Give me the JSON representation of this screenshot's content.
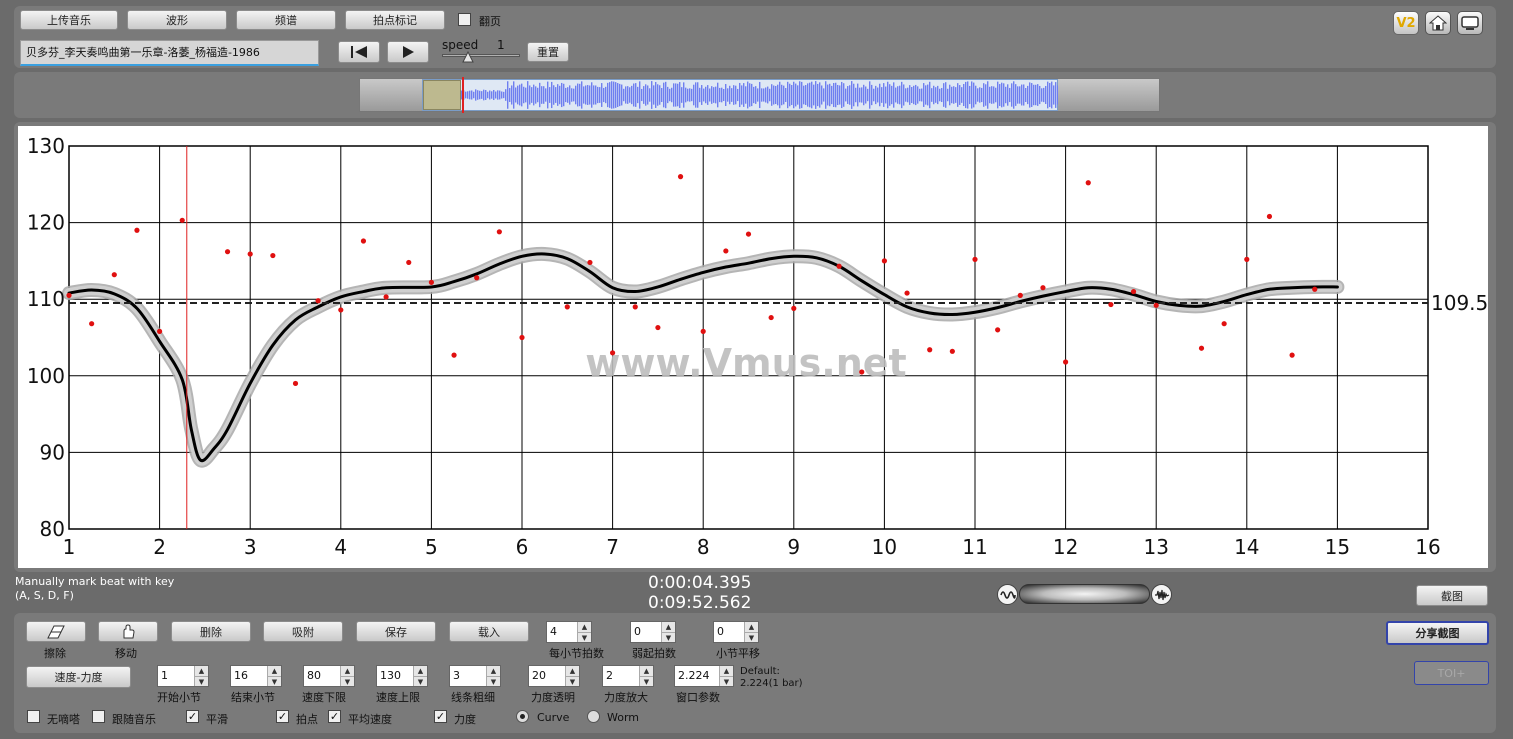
{
  "toolbar": {
    "upload": "上传音乐",
    "waveform": "波形",
    "spectrum": "频谱",
    "beat_mark": "拍点标记",
    "page_turn": "翻页",
    "title_value": "贝多芬_李天奏鸣曲第一乐章-洛萎_杨福造-1986",
    "speed_label": "speed",
    "speed_value": "1",
    "reset": "重置",
    "version_badge": "V2"
  },
  "overview": {
    "start_fraction": 0.058,
    "window_start": 0.078,
    "window_end": 0.873
  },
  "marker_note": "Manually mark beat with key",
  "marker_keys": "(A, S, D, F)",
  "time_current": "0:00:04.395",
  "time_total": "0:09:52.562",
  "screenshot_btn": "截图",
  "share_btn": "分享截图",
  "toi_btn": "TOI+",
  "watermark": "www.Vmus.net",
  "controls": {
    "erase": "擦除",
    "move": "移动",
    "delete": "删除",
    "snap": "吸附",
    "save": "保存",
    "load": "载入",
    "beats_per_bar_label": "每小节拍数",
    "beats_per_bar": "4",
    "pickup_label": "弱起拍数",
    "pickup": "0",
    "bar_shift_label": "小节平移",
    "bar_shift": "0",
    "tempo_dynamics": "速度-力度",
    "start_bar_label": "开始小节",
    "start_bar": "1",
    "end_bar_label": "结束小节",
    "end_bar": "16",
    "tempo_min_label": "速度下限",
    "tempo_min": "80",
    "tempo_max_label": "速度上限",
    "tempo_max": "130",
    "line_width_label": "线条粗细",
    "line_width": "3",
    "dyn_opacity_label": "力度透明",
    "dyn_opacity": "20",
    "dyn_scale_label": "力度放大",
    "dyn_scale": "2",
    "window_label": "窗口参数",
    "window": "2.224",
    "default_line1": "Default:",
    "default_line2": "2.224(1 bar)",
    "no_metronome": "无嘀嗒",
    "follow_music": "跟随音乐",
    "smooth": "平滑",
    "beats": "拍点",
    "avg_tempo": "平均速度",
    "dynamics": "力度",
    "curve": "Curve",
    "worm": "Worm"
  },
  "chart_data": {
    "type": "scatter",
    "xlim": [
      1,
      16
    ],
    "ylim": [
      80,
      130
    ],
    "x_ticks": [
      "1",
      "2",
      "3",
      "4",
      "5",
      "6",
      "7",
      "8",
      "9",
      "10",
      "11",
      "12",
      "13",
      "14",
      "15",
      "16"
    ],
    "y_ticks": [
      "130",
      "120",
      "110",
      "100",
      "90",
      "80"
    ],
    "average": 109.5,
    "average_label": "109.5",
    "cursor_x": 2.3,
    "points": [
      [
        1.0,
        110.5
      ],
      [
        1.25,
        106.8
      ],
      [
        1.5,
        113.2
      ],
      [
        1.75,
        119.0
      ],
      [
        2.0,
        105.8
      ],
      [
        2.25,
        120.3
      ],
      [
        2.75,
        116.2
      ],
      [
        3.0,
        115.9
      ],
      [
        3.25,
        115.7
      ],
      [
        3.5,
        99.0
      ],
      [
        3.75,
        109.8
      ],
      [
        4.0,
        108.6
      ],
      [
        4.25,
        117.6
      ],
      [
        4.5,
        110.3
      ],
      [
        4.75,
        114.8
      ],
      [
        5.0,
        112.2
      ],
      [
        5.25,
        102.7
      ],
      [
        5.5,
        112.8
      ],
      [
        5.75,
        118.8
      ],
      [
        6.0,
        105.0
      ],
      [
        6.5,
        109.0
      ],
      [
        6.75,
        114.8
      ],
      [
        7.0,
        103.0
      ],
      [
        7.25,
        109.0
      ],
      [
        7.5,
        106.3
      ],
      [
        7.75,
        126.0
      ],
      [
        8.0,
        105.8
      ],
      [
        8.25,
        116.3
      ],
      [
        8.5,
        118.5
      ],
      [
        8.75,
        107.6
      ],
      [
        9.0,
        108.8
      ],
      [
        9.5,
        114.3
      ],
      [
        9.75,
        100.5
      ],
      [
        10.0,
        115.0
      ],
      [
        10.25,
        110.8
      ],
      [
        10.5,
        103.4
      ],
      [
        10.75,
        103.2
      ],
      [
        11.0,
        115.2
      ],
      [
        11.25,
        106.0
      ],
      [
        11.5,
        110.5
      ],
      [
        11.75,
        111.5
      ],
      [
        12.0,
        101.8
      ],
      [
        12.25,
        125.2
      ],
      [
        12.5,
        109.3
      ],
      [
        12.75,
        111.0
      ],
      [
        13.0,
        109.2
      ],
      [
        13.5,
        103.6
      ],
      [
        13.75,
        106.8
      ],
      [
        14.0,
        115.2
      ],
      [
        14.25,
        120.8
      ],
      [
        14.5,
        102.7
      ],
      [
        14.75,
        111.3
      ]
    ],
    "curve": [
      [
        1.0,
        110.8
      ],
      [
        1.25,
        111.2
      ],
      [
        1.5,
        110.7
      ],
      [
        1.75,
        108.8
      ],
      [
        2.0,
        104.5
      ],
      [
        2.25,
        99.5
      ],
      [
        2.35,
        93.0
      ],
      [
        2.45,
        89.0
      ],
      [
        2.6,
        90.5
      ],
      [
        2.75,
        93.0
      ],
      [
        3.0,
        99.0
      ],
      [
        3.25,
        104.0
      ],
      [
        3.5,
        107.3
      ],
      [
        3.75,
        109.0
      ],
      [
        4.0,
        110.3
      ],
      [
        4.25,
        111.0
      ],
      [
        4.5,
        111.5
      ],
      [
        5.0,
        111.6
      ],
      [
        5.25,
        112.3
      ],
      [
        5.5,
        113.3
      ],
      [
        5.75,
        114.6
      ],
      [
        6.0,
        115.6
      ],
      [
        6.25,
        115.9
      ],
      [
        6.5,
        115.3
      ],
      [
        6.75,
        113.6
      ],
      [
        7.0,
        111.5
      ],
      [
        7.25,
        111.0
      ],
      [
        7.5,
        111.6
      ],
      [
        7.75,
        112.6
      ],
      [
        8.0,
        113.5
      ],
      [
        8.25,
        114.2
      ],
      [
        8.5,
        114.7
      ],
      [
        8.75,
        115.3
      ],
      [
        9.0,
        115.6
      ],
      [
        9.25,
        115.4
      ],
      [
        9.5,
        114.3
      ],
      [
        9.75,
        112.4
      ],
      [
        10.0,
        110.6
      ],
      [
        10.25,
        109.0
      ],
      [
        10.5,
        108.2
      ],
      [
        10.75,
        108.0
      ],
      [
        11.0,
        108.3
      ],
      [
        11.25,
        108.9
      ],
      [
        11.5,
        109.7
      ],
      [
        11.75,
        110.4
      ],
      [
        12.0,
        111.0
      ],
      [
        12.25,
        111.5
      ],
      [
        12.5,
        111.3
      ],
      [
        12.75,
        110.6
      ],
      [
        13.0,
        109.7
      ],
      [
        13.25,
        109.2
      ],
      [
        13.5,
        109.1
      ],
      [
        13.75,
        109.7
      ],
      [
        14.0,
        110.6
      ],
      [
        14.25,
        111.3
      ],
      [
        14.5,
        111.5
      ],
      [
        14.75,
        111.6
      ],
      [
        15.0,
        111.6
      ]
    ]
  }
}
